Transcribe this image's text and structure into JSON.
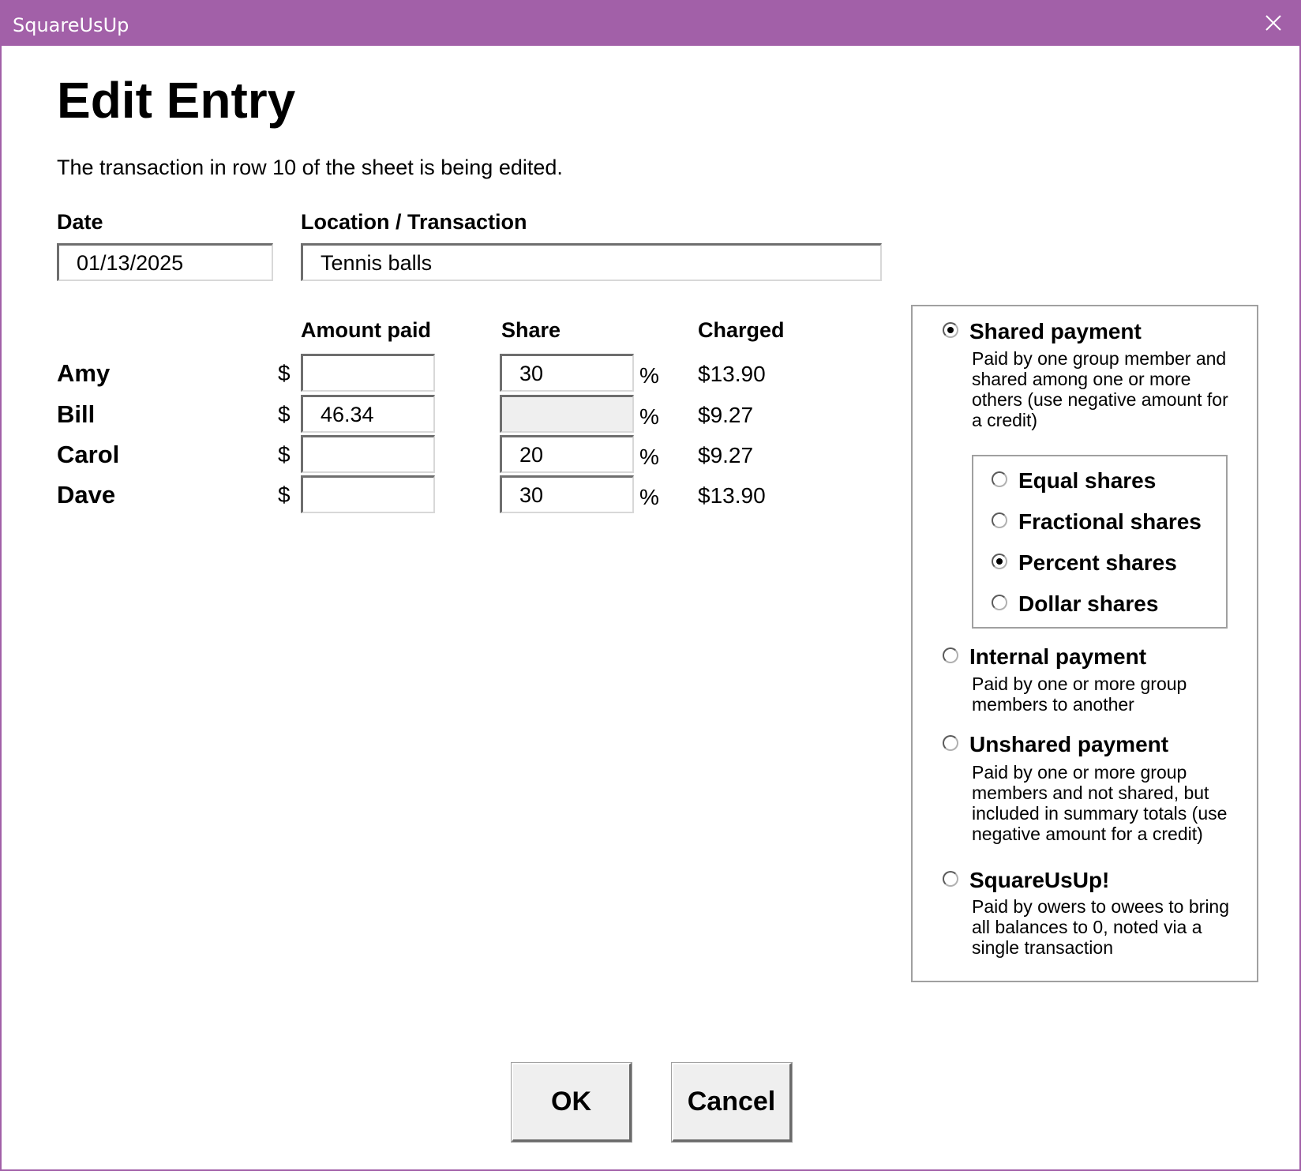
{
  "window": {
    "title": "SquareUsUp",
    "close_icon": "close-icon"
  },
  "colors": {
    "titlebar": "#a260a8",
    "disabled_field": "#efefef"
  },
  "form": {
    "heading": "Edit Entry",
    "subtitle": "The transaction in row 10 of the sheet is being edited.",
    "date_label": "Date",
    "date_value": "01/13/2025",
    "location_label": "Location / Transaction",
    "location_value": "Tennis balls"
  },
  "table": {
    "headers": {
      "amount_paid": "Amount paid",
      "share": "Share",
      "charged": "Charged"
    },
    "currency_symbol": "$",
    "percent_symbol": "%",
    "rows": [
      {
        "name": "Amy",
        "amount": "",
        "share": "30",
        "share_enabled": true,
        "charged": "$13.90"
      },
      {
        "name": "Bill",
        "amount": "46.34",
        "share": "",
        "share_enabled": false,
        "charged": "$9.27"
      },
      {
        "name": "Carol",
        "amount": "",
        "share": "20",
        "share_enabled": true,
        "charged": "$9.27"
      },
      {
        "name": "Dave",
        "amount": "",
        "share": "30",
        "share_enabled": true,
        "charged": "$13.90"
      }
    ]
  },
  "payment_types": {
    "selected": "shared",
    "shared": {
      "label": "Shared payment",
      "description": "Paid by one group member and shared among one or more others (use negative amount for a credit)"
    },
    "share_modes": {
      "selected": "percent",
      "equal": "Equal shares",
      "fractional": "Fractional shares",
      "percent": "Percent shares",
      "dollar": "Dollar shares"
    },
    "internal": {
      "label": "Internal payment",
      "description": "Paid by one or more group members to another"
    },
    "unshared": {
      "label": "Unshared payment",
      "description": "Paid by one or more group members and not shared, but included in summary totals (use negative amount for a credit)"
    },
    "squareusup": {
      "label": "SquareUsUp!",
      "description": "Paid by owers to owees to bring all balances to 0, noted via a single transaction"
    }
  },
  "buttons": {
    "ok": "OK",
    "cancel": "Cancel"
  }
}
